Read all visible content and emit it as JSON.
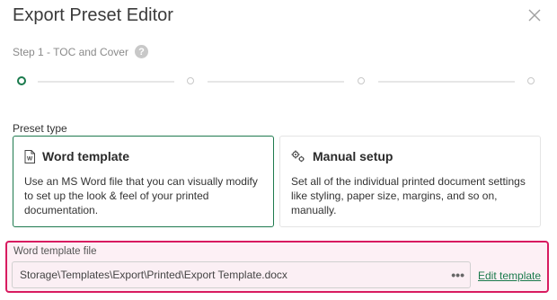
{
  "dialog": {
    "title": "Export Preset Editor",
    "close_icon": "close-icon"
  },
  "stepper": {
    "current_label": "Step 1 - TOC and Cover",
    "help_glyph": "?",
    "total_steps": 4,
    "current_step": 1,
    "active_color": "#1a7a4c"
  },
  "preset_type": {
    "label": "Preset type",
    "options": [
      {
        "title": "Word template",
        "icon": "word-document-icon",
        "description": "Use an MS Word file that you can visually modify to set up the look & feel of your printed documentation.",
        "selected": true
      },
      {
        "title": "Manual setup",
        "icon": "gears-icon",
        "description": "Set all of the individual printed document settings like styling, paper size, margins, and so on, manually.",
        "selected": false
      }
    ]
  },
  "template_file": {
    "label": "Word template file",
    "value": "Storage\\Templates\\Export\\Printed\\Export Template.docx",
    "more_label": "•••",
    "edit_link": "Edit template",
    "highlight_color": "#d81b60"
  }
}
